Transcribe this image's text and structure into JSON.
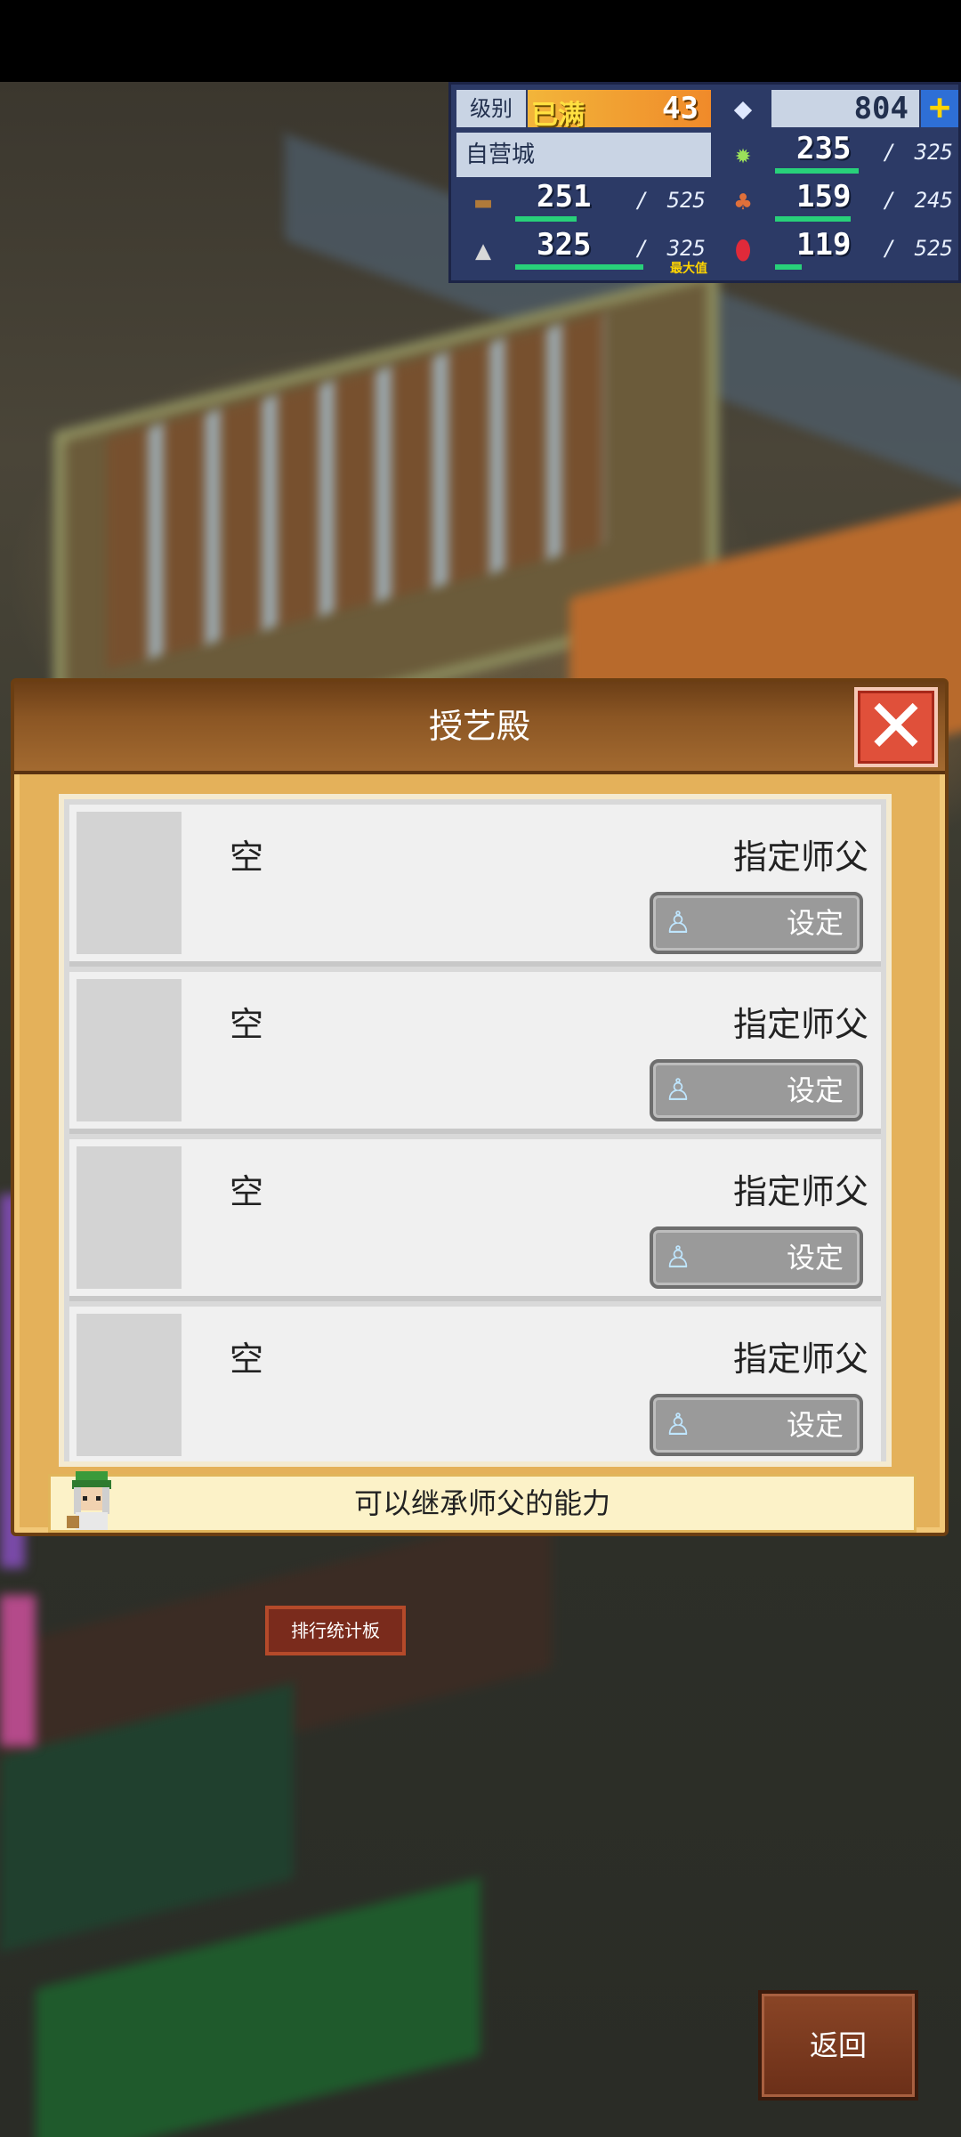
{
  "hud": {
    "level_label": "级别",
    "level_status": "已满",
    "level": "43",
    "gems": "804",
    "plus_label": "+",
    "city_name": "自营城",
    "resources": {
      "crop": {
        "icon": "wheat-icon",
        "current": "235",
        "max": "325",
        "fraction": 0.72
      },
      "wood": {
        "icon": "wood-log-icon",
        "current": "251",
        "max": "525",
        "fraction": 0.48
      },
      "food": {
        "icon": "food-basket-icon",
        "current": "159",
        "max": "245",
        "fraction": 0.65
      },
      "stone": {
        "icon": "ore-icon",
        "current": "325",
        "max": "325",
        "fraction": 1.0,
        "note": "最大值"
      },
      "ruby": {
        "icon": "ruby-icon",
        "current": "119",
        "max": "525",
        "fraction": 0.23
      }
    }
  },
  "dialog": {
    "title": "授艺殿",
    "close_icon": "close-icon",
    "slots": [
      {
        "name": "空",
        "master_label": "指定师父",
        "button_label": "设定"
      },
      {
        "name": "空",
        "master_label": "指定师父",
        "button_label": "设定"
      },
      {
        "name": "空",
        "master_label": "指定师父",
        "button_label": "设定"
      },
      {
        "name": "空",
        "master_label": "指定师父",
        "button_label": "设定"
      }
    ],
    "tip": "可以继承师父的能力"
  },
  "scene": {
    "rank_sign": "排行统计板"
  },
  "back_label": "返回",
  "colors": {
    "accent": "#e4b15a",
    "header": "#8b5624",
    "close": "#e0503a",
    "hud": "#2c3a66"
  }
}
